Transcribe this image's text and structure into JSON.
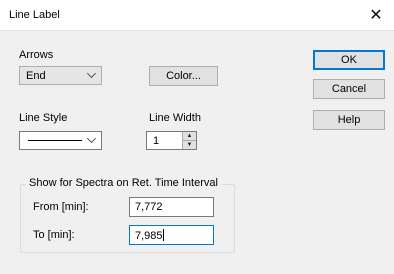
{
  "dialog": {
    "title": "Line Label"
  },
  "arrows": {
    "label": "Arrows",
    "value": "End"
  },
  "color_button": "Color...",
  "line_style": {
    "label": "Line Style"
  },
  "line_width": {
    "label": "Line Width",
    "value": "1"
  },
  "group": {
    "label": "Show for Spectra on Ret. Time Interval",
    "from_label": "From [min]:",
    "from_value": "7,772",
    "to_label": "To [min]:",
    "to_value": "7,985"
  },
  "buttons": {
    "ok": "OK",
    "cancel": "Cancel",
    "help": "Help"
  },
  "icons": {
    "close": "close-icon",
    "dropdown": "chevron-down-icon",
    "spin": "spin-arrows-icon"
  }
}
